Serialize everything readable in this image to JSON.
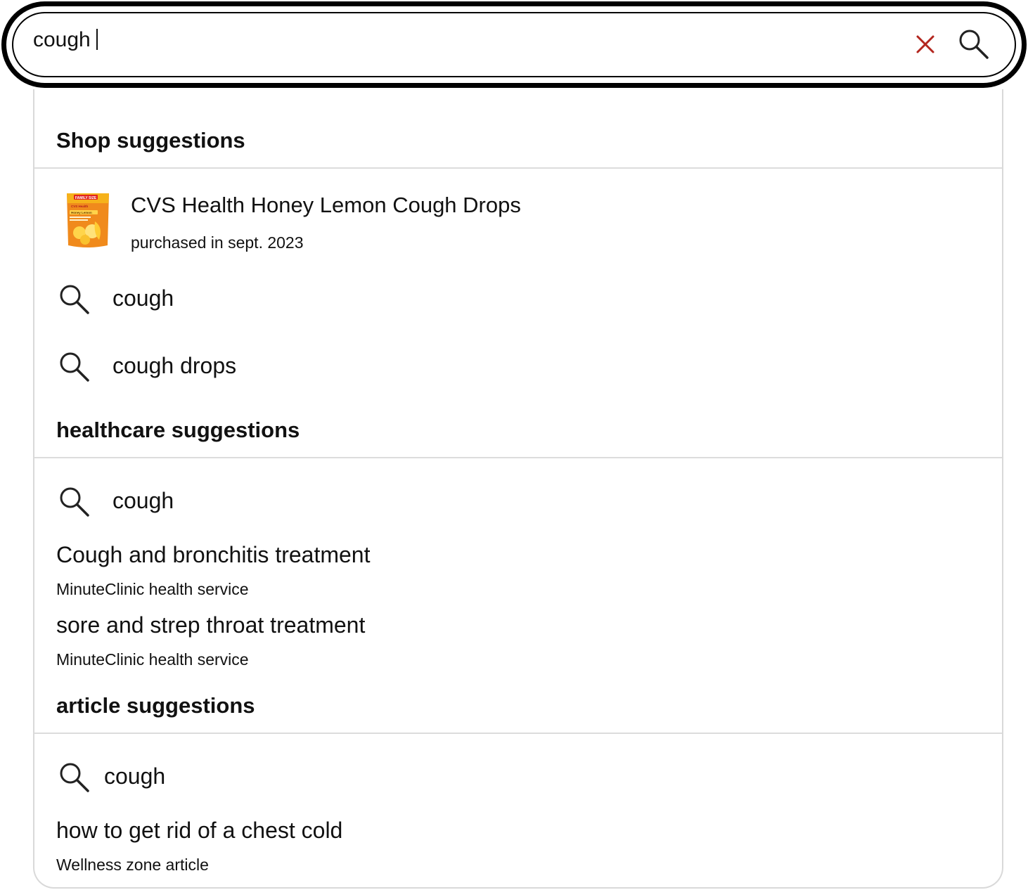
{
  "search": {
    "query": "cough",
    "clear_icon": "close-icon",
    "submit_icon": "search-icon",
    "clear_color": "#b3261e"
  },
  "shop": {
    "title": "Shop suggestions",
    "product": {
      "name": "CVS Health Honey Lemon Cough Drops",
      "subtitle": "purchased in sept. 2023",
      "image_label": "FAMILY SIZE",
      "image_brand": "CVS Health",
      "image_flavor": "Honey Lemon"
    },
    "queries": [
      "cough",
      "cough drops"
    ]
  },
  "healthcare": {
    "title": "healthcare suggestions",
    "query": "cough",
    "services": [
      {
        "title": "Cough and bronchitis treatment",
        "subtitle": "MinuteClinic health service"
      },
      {
        "title": "sore and strep throat treatment",
        "subtitle": "MinuteClinic health service"
      }
    ]
  },
  "articles": {
    "title": "article suggestions",
    "query": "cough",
    "items": [
      {
        "title": "how to get rid of a chest cold",
        "subtitle": "Wellness zone article"
      }
    ]
  }
}
